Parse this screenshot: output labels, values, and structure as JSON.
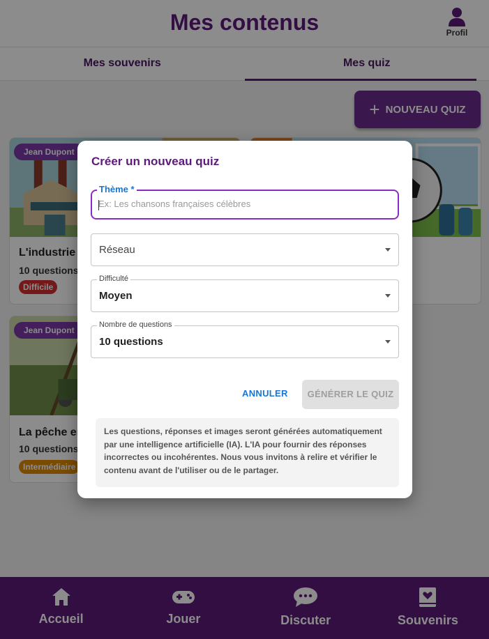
{
  "header": {
    "title": "Mes contenus",
    "profile_label": "Profil"
  },
  "tabs": [
    {
      "label": "Mes souvenirs",
      "active": false
    },
    {
      "label": "Mes quiz",
      "active": true
    }
  ],
  "new_quiz_button": "NOUVEAU QUIZ",
  "cards": [
    {
      "author": "Jean Dupont",
      "title": "L'industrie f",
      "questions": "10 questions",
      "difficulty": "Difficile",
      "difficulty_color": "#d32f2f"
    },
    {
      "author": "",
      "title": "",
      "questions": "",
      "difficulty": ""
    },
    {
      "author": "Jean Dupont",
      "title": "La pêche en",
      "questions": "10 questions",
      "difficulty": "Intermédiaire",
      "difficulty_color": "#e08a00"
    }
  ],
  "bottom_nav": [
    {
      "label": "Accueil",
      "icon": "home-icon"
    },
    {
      "label": "Jouer",
      "icon": "gamepad-icon"
    },
    {
      "label": "Discuter",
      "icon": "chat-icon"
    },
    {
      "label": "Souvenirs",
      "icon": "book-heart-icon"
    }
  ],
  "dialog": {
    "title": "Créer un nouveau quiz",
    "theme": {
      "label": "Thème *",
      "placeholder": "Ex: Les chansons françaises célèbres",
      "value": ""
    },
    "network": {
      "value": "Réseau"
    },
    "difficulty": {
      "label": "Difficulté",
      "value": "Moyen"
    },
    "num_questions": {
      "label": "Nombre de questions",
      "value": "10 questions"
    },
    "cancel_label": "ANNULER",
    "generate_label": "GÉNÉRER LE QUIZ",
    "disclaimer": "Les questions, réponses et images seront générées automatiquement par une intelligence artificielle (IA). L'IA pour fournir des réponses incorrectes ou incohérentes. Nous vous invitons à relire et vérifier le contenu avant de l'utiliser ou de le partager."
  },
  "colors": {
    "brand": "#5c1a7a",
    "accent_blue": "#1976d2",
    "focus": "#8a2bc4"
  }
}
